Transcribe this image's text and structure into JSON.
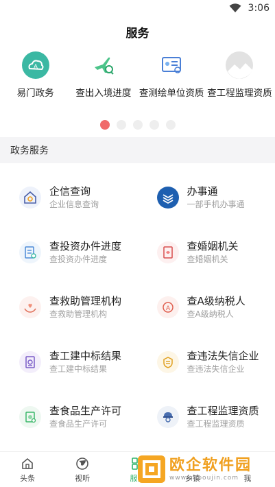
{
  "status_bar": {
    "time": "3:06"
  },
  "header": {
    "title": "服务"
  },
  "carousel": {
    "items": [
      {
        "label": "易门政务",
        "icon": "yimen-gov-icon"
      },
      {
        "label": "查出入境进度",
        "icon": "airplane-search-icon"
      },
      {
        "label": "查测绘单位资质",
        "icon": "id-card-icon"
      },
      {
        "label": "查工程监理资质",
        "icon": "placeholder-image-icon"
      }
    ],
    "page_count": 5,
    "active_page": 1
  },
  "section": {
    "title": "政务服务"
  },
  "services": [
    {
      "title": "企信查询",
      "subtitle": "企业信息查询",
      "icon": "enterprise-info-icon"
    },
    {
      "title": "办事通",
      "subtitle": "一部手机办事通",
      "icon": "banshitong-icon"
    },
    {
      "title": "查投资办件进度",
      "subtitle": "查投资办件进度",
      "icon": "document-search-icon"
    },
    {
      "title": "查婚姻机关",
      "subtitle": "查婚姻机关",
      "icon": "marriage-document-icon"
    },
    {
      "title": "查救助管理机构",
      "subtitle": "查救助管理机构",
      "icon": "hands-care-icon"
    },
    {
      "title": "查A级纳税人",
      "subtitle": "查A级纳税人",
      "icon": "taxpayer-badge-icon"
    },
    {
      "title": "查工建中标结果",
      "subtitle": "查工建中标结果",
      "icon": "bid-result-icon"
    },
    {
      "title": "查违法失信企业",
      "subtitle": "查违法失信企业",
      "icon": "credit-shield-icon"
    },
    {
      "title": "查食品生产许可",
      "subtitle": "查食品生产许可",
      "icon": "food-license-icon"
    },
    {
      "title": "查工程监理资质",
      "subtitle": "查工程监理资质",
      "icon": "engineer-helmet-icon"
    }
  ],
  "tabbar": {
    "tabs": [
      {
        "label": "头条",
        "icon": "home-icon"
      },
      {
        "label": "视听",
        "icon": "globe-icon"
      },
      {
        "label": "服务",
        "icon": "grid-icon"
      },
      {
        "label": "乡镇",
        "icon": "town-icon"
      },
      {
        "label": "我",
        "icon": "user-icon"
      }
    ],
    "active": "服务"
  },
  "watermark": {
    "title": "欧企软件园",
    "url": "www.qapoujin.com"
  },
  "colors": {
    "accent": "#2db36a",
    "dot_active": "#f06a6a",
    "section_bg": "#f4f4f6",
    "subtitle": "#a0a0a0"
  }
}
